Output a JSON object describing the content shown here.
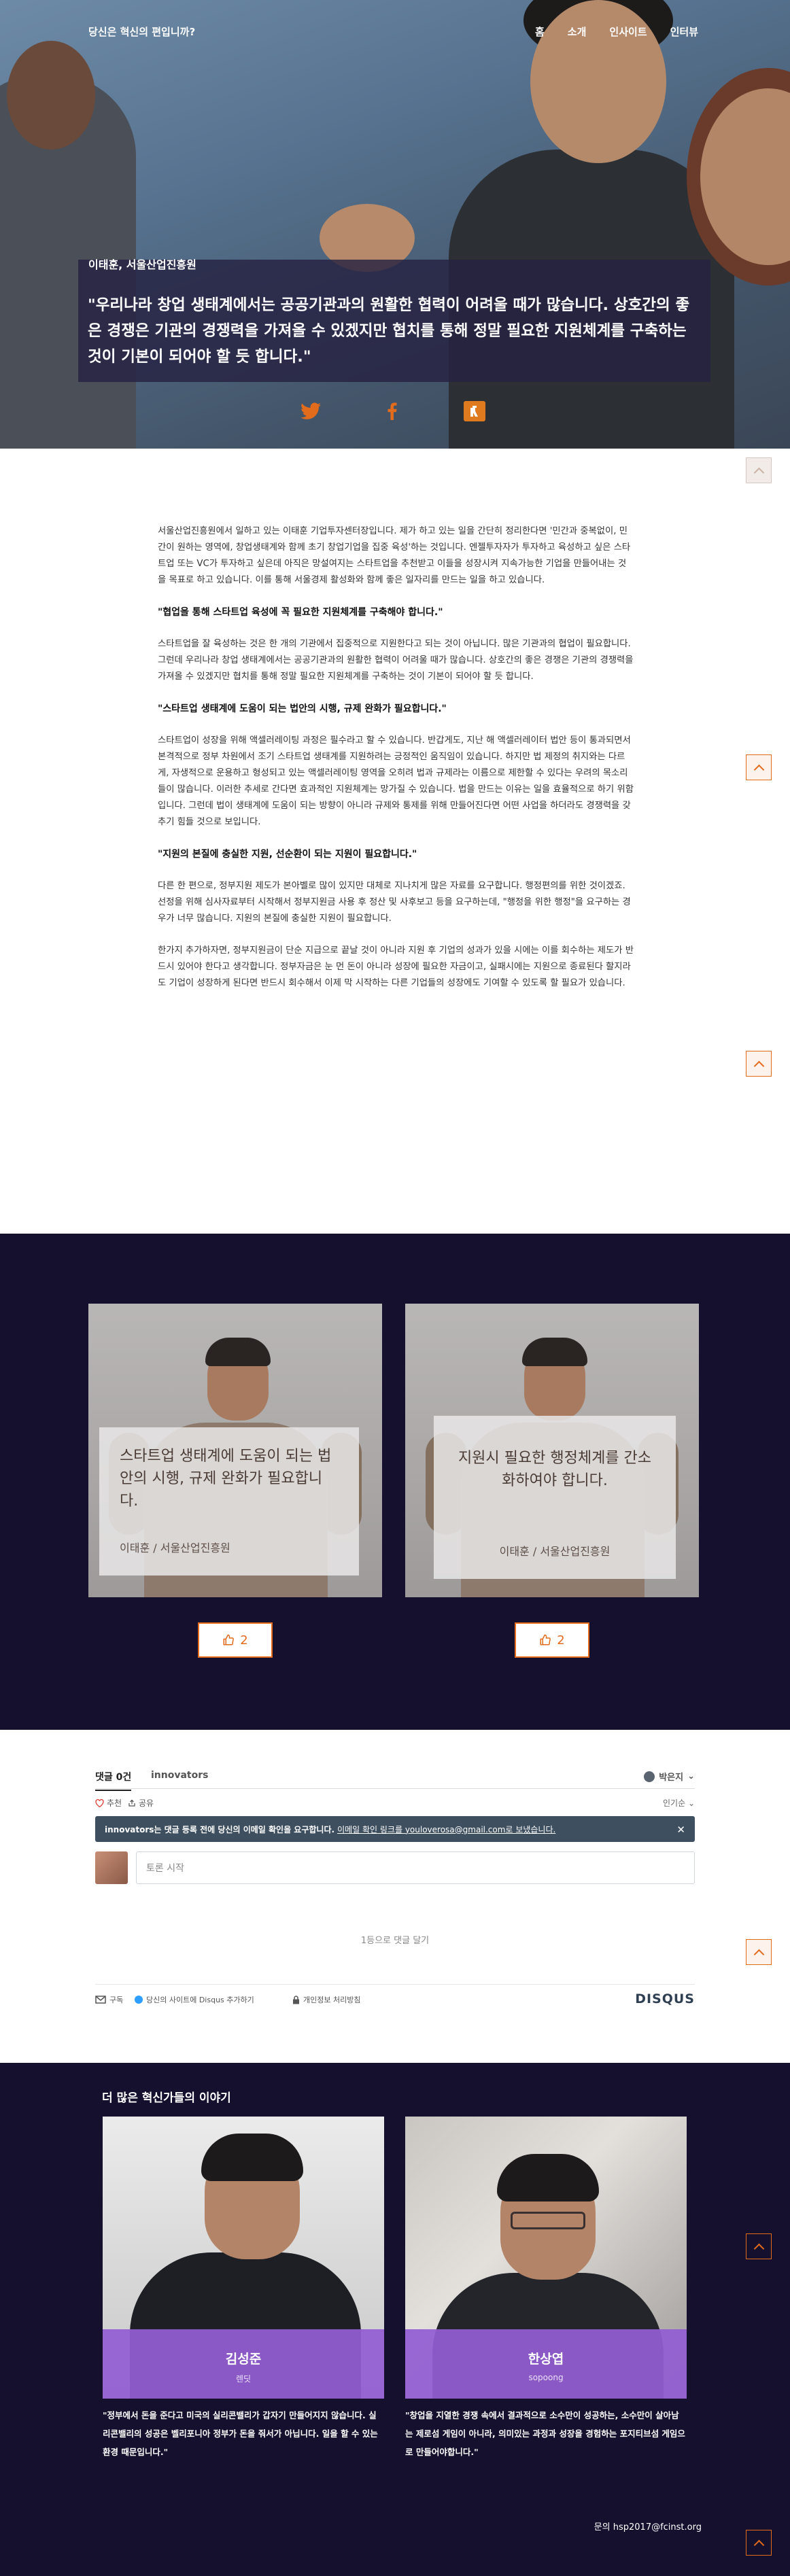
{
  "header": {
    "brand": "당신은 혁신의 편입니까?",
    "menu": [
      "홈",
      "소개",
      "인사이트",
      "인터뷰"
    ]
  },
  "hero": {
    "speaker": "이태훈, 서울산업진흥원",
    "quote": "\"우리나라 창업 생태계에서는 공공기관과의 원활한 협력이 어려울 때가 많습니다. 상호간의 좋은 경쟁은 기관의 경쟁력을 가져올 수 있겠지만 협치를 통해 정말 필요한 지원체계를 구축하는 것이 기본이 되어야 할 듯 합니다.\"",
    "share_icons": [
      "twitter-icon",
      "facebook-icon",
      "kakaostory-icon"
    ]
  },
  "article": {
    "paragraphs": [
      "서울산업진흥원에서 일하고 있는 이태훈 기업투자센터장입니다. 제가 하고 있는 일을 간단히 정리한다면 '민간과 중복없이, 민간이 원하는 영역에, 창업생태계와 함께 초기 창업기업을 집중 육성'하는 것입니다. 엔젤투자자가 투자하고 육성하고 싶은 스타트업 또는 VC가 투자하고 싶은데 아직은 망설여지는 스타트업을 추천받고 이들을 성장시켜 지속가능한 기업을 만들어내는 것을 목표로 하고 있습니다. 이를 통해 서울경제 활성화와 함께 좋은 일자리를 만드는 일을 하고 있습니다.",
      "\"협업을 통해 스타트업 육성에 꼭 필요한 지원체계를 구축해야 합니다.\"",
      "스타트업을 잘 육성하는 것은 한 개의 기관에서 집중적으로  지원한다고 되는 것이 아닙니다. 많은 기관과의 협업이 필요합니다. 그런데 우리나라 창업 생태계에서는 공공기관과의 원활한 협력이 어려울 때가 많습니다. 상호간의 좋은 경쟁은 기관의 경쟁력을 가져올 수 있겠지만 협치를 통해 정말 필요한 지원체계를 구축하는 것이 기본이 되어야 할 듯 합니다.",
      "\"스타트업 생태계에 도움이 되는 법안의 시행, 규제 완화가 필요합니다.\"",
      "스타트업이 성장을 위해 액셀러레이팅 과정은 필수라고 할 수 있습니다. 반갑게도, 지난 해 액셀러레이터 법안 등이 통과되면서 본격적으로 정부 차원에서 조기 스타트업 생태계를 지원하려는 긍정적인 움직임이 있습니다. 하지만 법 제정의 취지와는 다르게, 자생적으로 운용하고 형성되고 있는 액셀러레이팅 영역을 오히려 법과 규제라는 이름으로 제한할 수 있다는 우려의 목소리들이 많습니다. 이러한 추세로 간다면  효과적인 지원체계는 망가질 수 있습니다. 법을 만드는 이유는 일을 효율적으로 하기 위함입니다. 그런데 법이 생태계에 도움이 되는 방향이 아니라 규제와 통제를 위해 만들어진다면 어떤 사업을 하더라도 경쟁력을 갖추기 힘들 것으로 보입니다.",
      "\"지원의 본질에 충실한 지원, 선순환이 되는 지원이 필요합니다.\"",
      "다른 한 편으로, 정부지원 제도가 본아벨로 많이 있지만 대체로 지나치게 많은 자료를 요구합니다. 행정편의를 위한 것이겠죠. 선정을 위해 심사자료부터 시작해서 정부지원금 사용 후 정산 및 사후보고 등을 요구하는데, \"행정을 위한 행정\"을 요구하는 경우가 너무 많습니다. 지원의 본질에 충실한 지원이 필요합니다.",
      "한가지 추가하자면, 정부지원금이 단순 지급으로 끝날 것이 아니라 지원 후 기업의 성과가 있을 시에는 이를 회수하는 제도가 반드시 있어야 한다고 생각합니다. 정부자금은 눈 먼 돈이 아니라 성장에 필요한 자금이고, 실패시에는 지원으로 종료된다 할지라도 기업이 성장하게 된다면 반드시 회수해서 이제 막 시작하는 다른 기업들의 성장에도  기여할 수 있도록 할 필요가 있습니다."
    ]
  },
  "cards": [
    {
      "title": "스타트업 생태계에 도움이 되는 법안의 시행, 규제 완화가 필요합니다.",
      "sub": "이태훈 / 서울산업진흥원",
      "likes": "2"
    },
    {
      "title": "지원시 필요한 행정체계를 간소화하여야 합니다.",
      "sub": "이태훈 / 서울산업진흥원",
      "likes": "2"
    }
  ],
  "comments": {
    "tab_count": "댓글 0건",
    "tab_site": "innovators",
    "user": "박은지",
    "recommend": "추천",
    "share": "공유",
    "sort": "인기순",
    "alert_bold": "innovators는 댓글 등록 전에 당신의 이메일 확인을 요구합니다.",
    "alert_link": "이메일 확인 링크를 youloverosa@gmail.com로 보냈습니다.",
    "input_placeholder": "토론 시작",
    "first_comment": "1등으로 댓글 달기",
    "footer_subscribe": "구독",
    "footer_add": "당신의 사이트에 Disqus 추가하기",
    "footer_privacy": "개인정보 처리방침",
    "brand": "DISQUS"
  },
  "more": {
    "title": "더 많은 혁신가들의 이야기",
    "stories": [
      {
        "name": "김성준",
        "org": "렌딧",
        "quote": "\"정부에서 돈을 준다고 미국의 실리콘밸리가 갑자기 만들어지지 않습니다. 실리콘밸리의 성공은 벨리포니아 정부가 돈을 줘서가 아닙니다. 일을 할 수 있는 환경 때문입니다.\""
      },
      {
        "name": "한상엽",
        "org": "sopoong",
        "quote": "\"창업을 지열한 경쟁 속에서 결과적으로 소수만이 성공하는, 소수만이 살아남는 제로섬 게임이 아니라, 의미있는 과정과 성장을 경험하는 포지티브섬 게임으로 만들어야합니다.\""
      }
    ]
  },
  "contact": "문의 hsp2017@fcinst.org",
  "colors": {
    "accent": "#e36b1c",
    "dark_bg": "#14102e",
    "purple_band": "#925ed2"
  }
}
